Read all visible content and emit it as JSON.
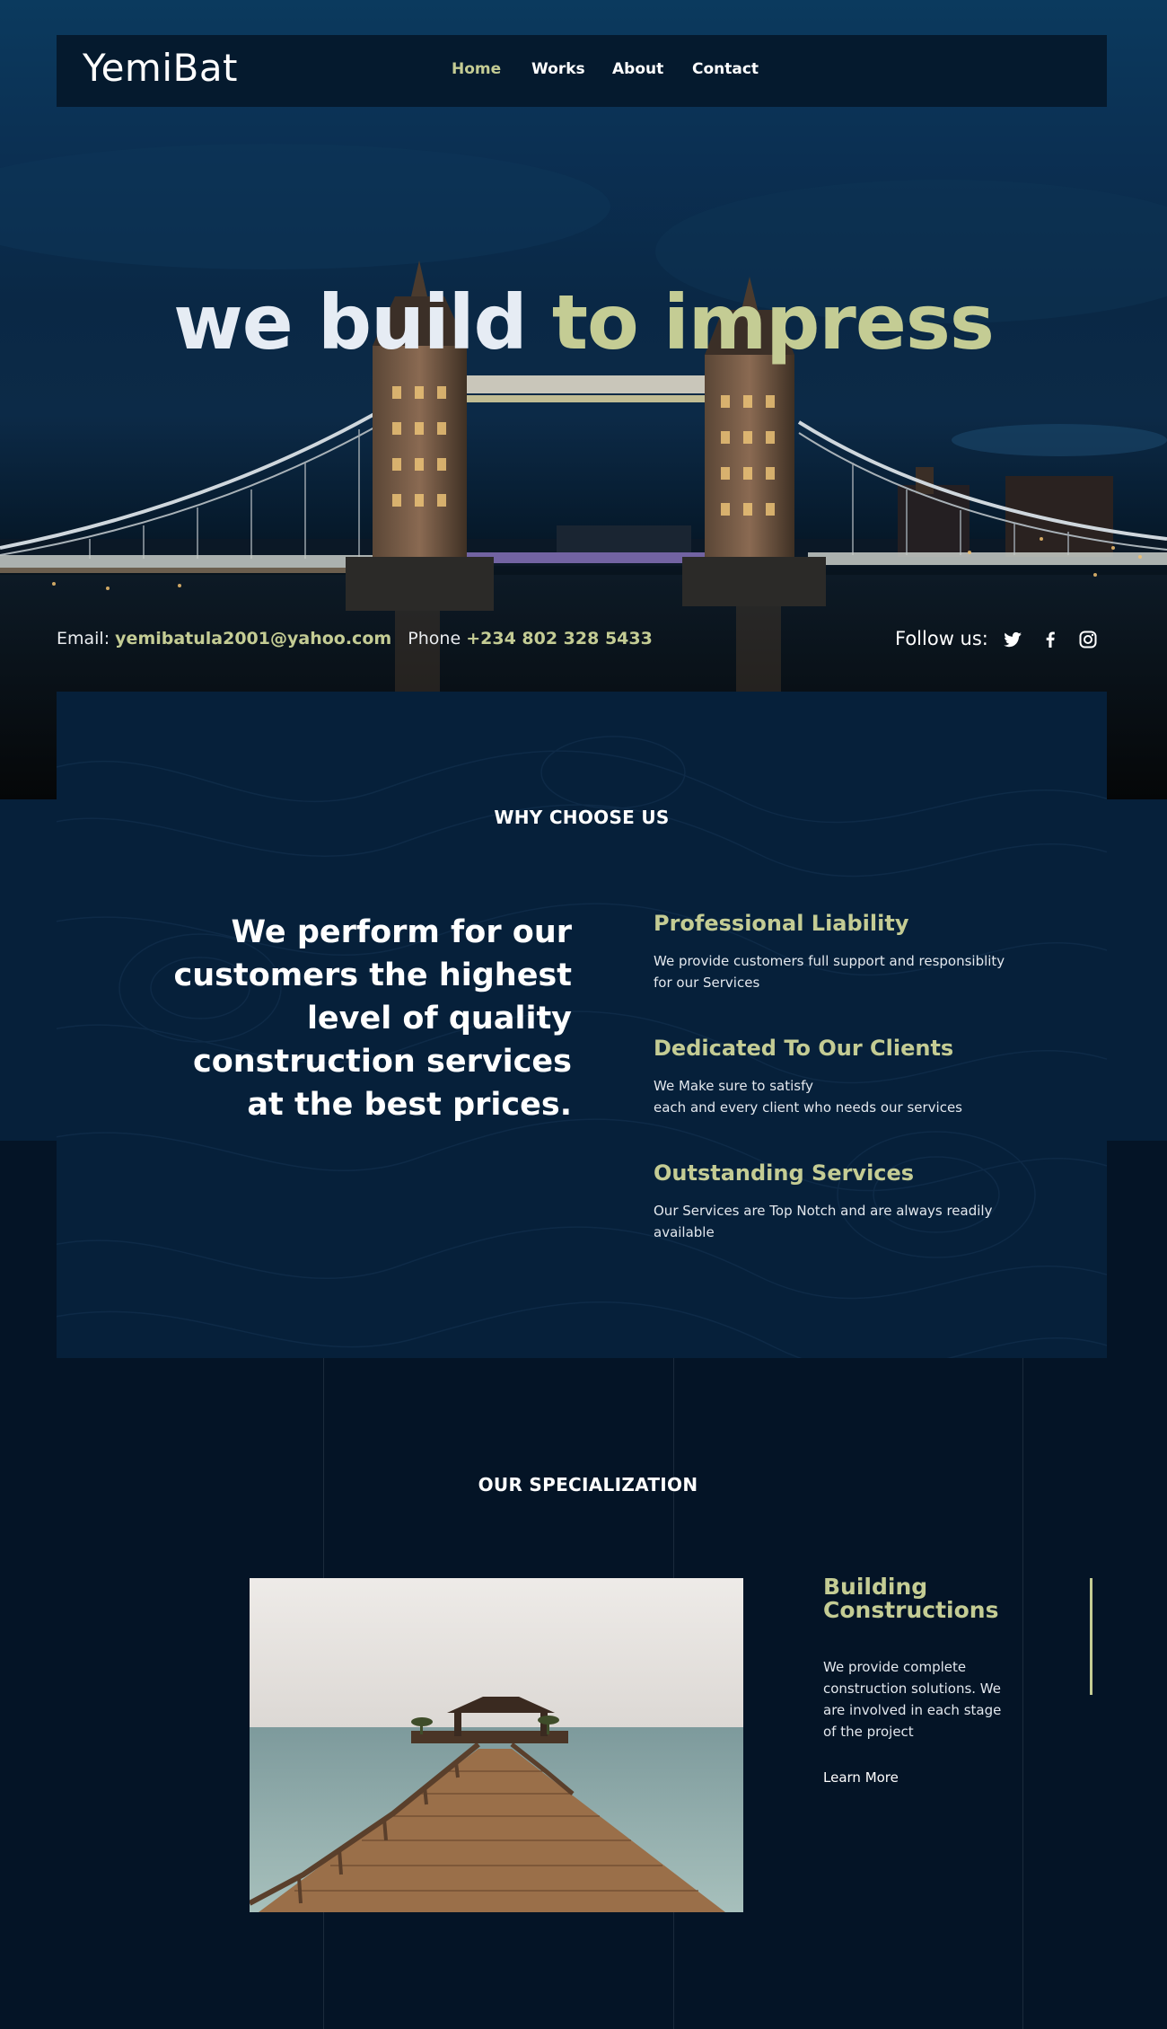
{
  "brand": {
    "logo": "YemiBat"
  },
  "nav": [
    {
      "label": "Home",
      "active": true
    },
    {
      "label": "Works",
      "active": false
    },
    {
      "label": "About",
      "active": false
    },
    {
      "label": "Contact",
      "active": false
    }
  ],
  "hero": {
    "headline_part1": "we build",
    "headline_part2": "to impress",
    "email_label": "Email:",
    "email": "yemibatula2001@yahoo.com",
    "phone_label": "Phone",
    "phone": "+234 802 328 5433",
    "follow_label": "Follow us:",
    "social": [
      "twitter-icon",
      "facebook-icon",
      "instagram-icon"
    ]
  },
  "why": {
    "title": "WHY CHOOSE US",
    "lead": "We perform for our customers the highest level of quality construction services at the best prices.",
    "features": [
      {
        "title": "Professional Liability",
        "text": "We provide customers full support and responsiblity for our Services"
      },
      {
        "title": "Dedicated To Our Clients",
        "text": "We Make sure to satisfy\neach and every client who needs our services"
      },
      {
        "title": "Outstanding Services",
        "text": "Our Services are Top Notch and are always readily available"
      }
    ]
  },
  "specialization": {
    "title": "OUR SPECIALIZATION",
    "item_title": "Building Constructions",
    "item_text": "We provide complete construction solutions. We are involved in each stage of the project",
    "learn_more": "Learn More"
  },
  "colors": {
    "accent": "#c4cc94",
    "navy": "#06203a",
    "page": "#041426",
    "navbar": "#051a2e"
  }
}
